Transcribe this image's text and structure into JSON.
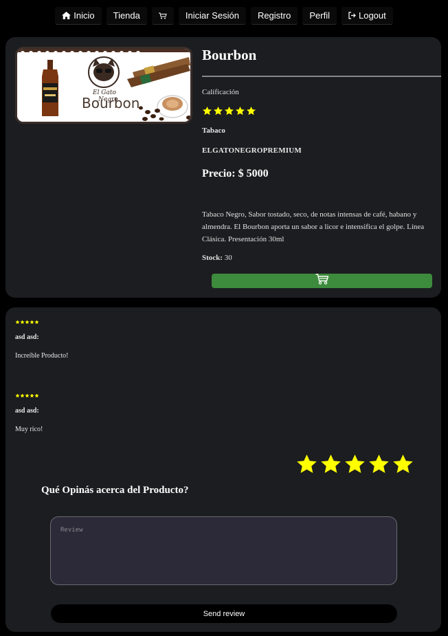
{
  "nav": {
    "items": [
      {
        "label": "Inicio",
        "icon": "home-icon"
      },
      {
        "label": "Tienda"
      },
      {
        "label": "",
        "icon": "cart-icon"
      },
      {
        "label": "Iniciar Sesión"
      },
      {
        "label": "Registro"
      },
      {
        "label": "Perfil"
      },
      {
        "label": "Logout",
        "icon": "logout-icon"
      }
    ]
  },
  "product": {
    "title": "Bourbon",
    "image_brand_text": "Bourbon",
    "image_logo_text": "El Gato Negro",
    "rating_label": "Calificación",
    "rating": 5,
    "category": "Tabaco",
    "brand": "ELGATONEGROPREMIUM",
    "price": "Precio: $ 5000",
    "description": "Tabaco Negro, Sabor tostado, seco, de notas intensas de café, habano y almendra. El Bourbon aporta un sabor a licor e intensifica el golpe. Línea Clásica. Presentación 30ml",
    "stock_label": "Stock:",
    "stock_value": "30"
  },
  "reviews": [
    {
      "rating": 5,
      "author": "asd asd:",
      "text": "Increíble Producto!"
    },
    {
      "rating": 5,
      "author": "asd asd:",
      "text": "Muy rico!"
    }
  ],
  "review_form": {
    "rating": 5,
    "title": "Qué Opinás acerca del Producto?",
    "placeholder": "Review",
    "value": "",
    "send_label": "Send review"
  },
  "colors": {
    "star": "#ffff00",
    "cart_button": "#3d8b3d",
    "card_bg": "#1c1d20"
  }
}
